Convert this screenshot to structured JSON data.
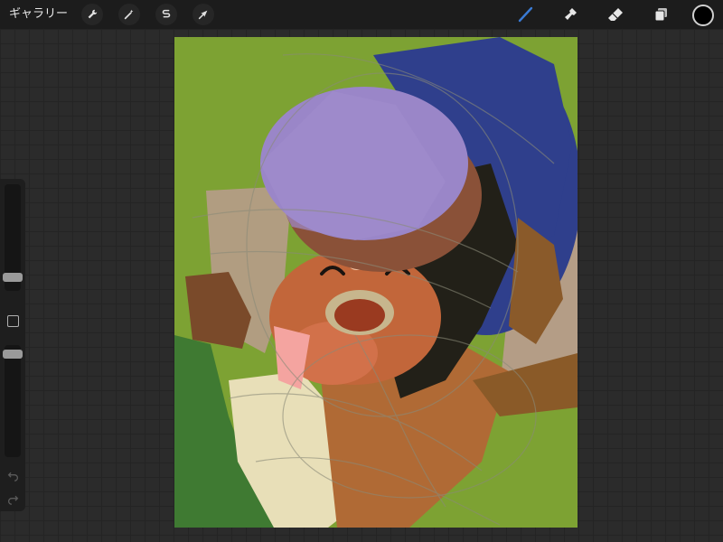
{
  "topbar": {
    "gallery_label": "ギャラリー",
    "left_tools": [
      {
        "name": "actions",
        "icon": "wrench-icon"
      },
      {
        "name": "adjustments",
        "icon": "magic-wand-icon"
      },
      {
        "name": "selection",
        "icon": "selection-s-icon"
      },
      {
        "name": "transform",
        "icon": "arrow-cursor-icon"
      }
    ],
    "right_tools": [
      {
        "name": "brush",
        "icon": "brush-icon",
        "active": true
      },
      {
        "name": "smudge",
        "icon": "smudge-icon"
      },
      {
        "name": "eraser",
        "icon": "eraser-icon"
      },
      {
        "name": "layers",
        "icon": "layers-icon"
      }
    ],
    "current_color": "#000000"
  },
  "colors": {
    "active_tool": "#3a7bd5",
    "canvas_background": "#7da233"
  },
  "sidebar": {
    "brush_size_icon": "slider",
    "brush_opacity_icon": "slider",
    "modify_icon": "square-icon",
    "undo_icon": "undo-icon",
    "redo_icon": "redo-icon"
  }
}
